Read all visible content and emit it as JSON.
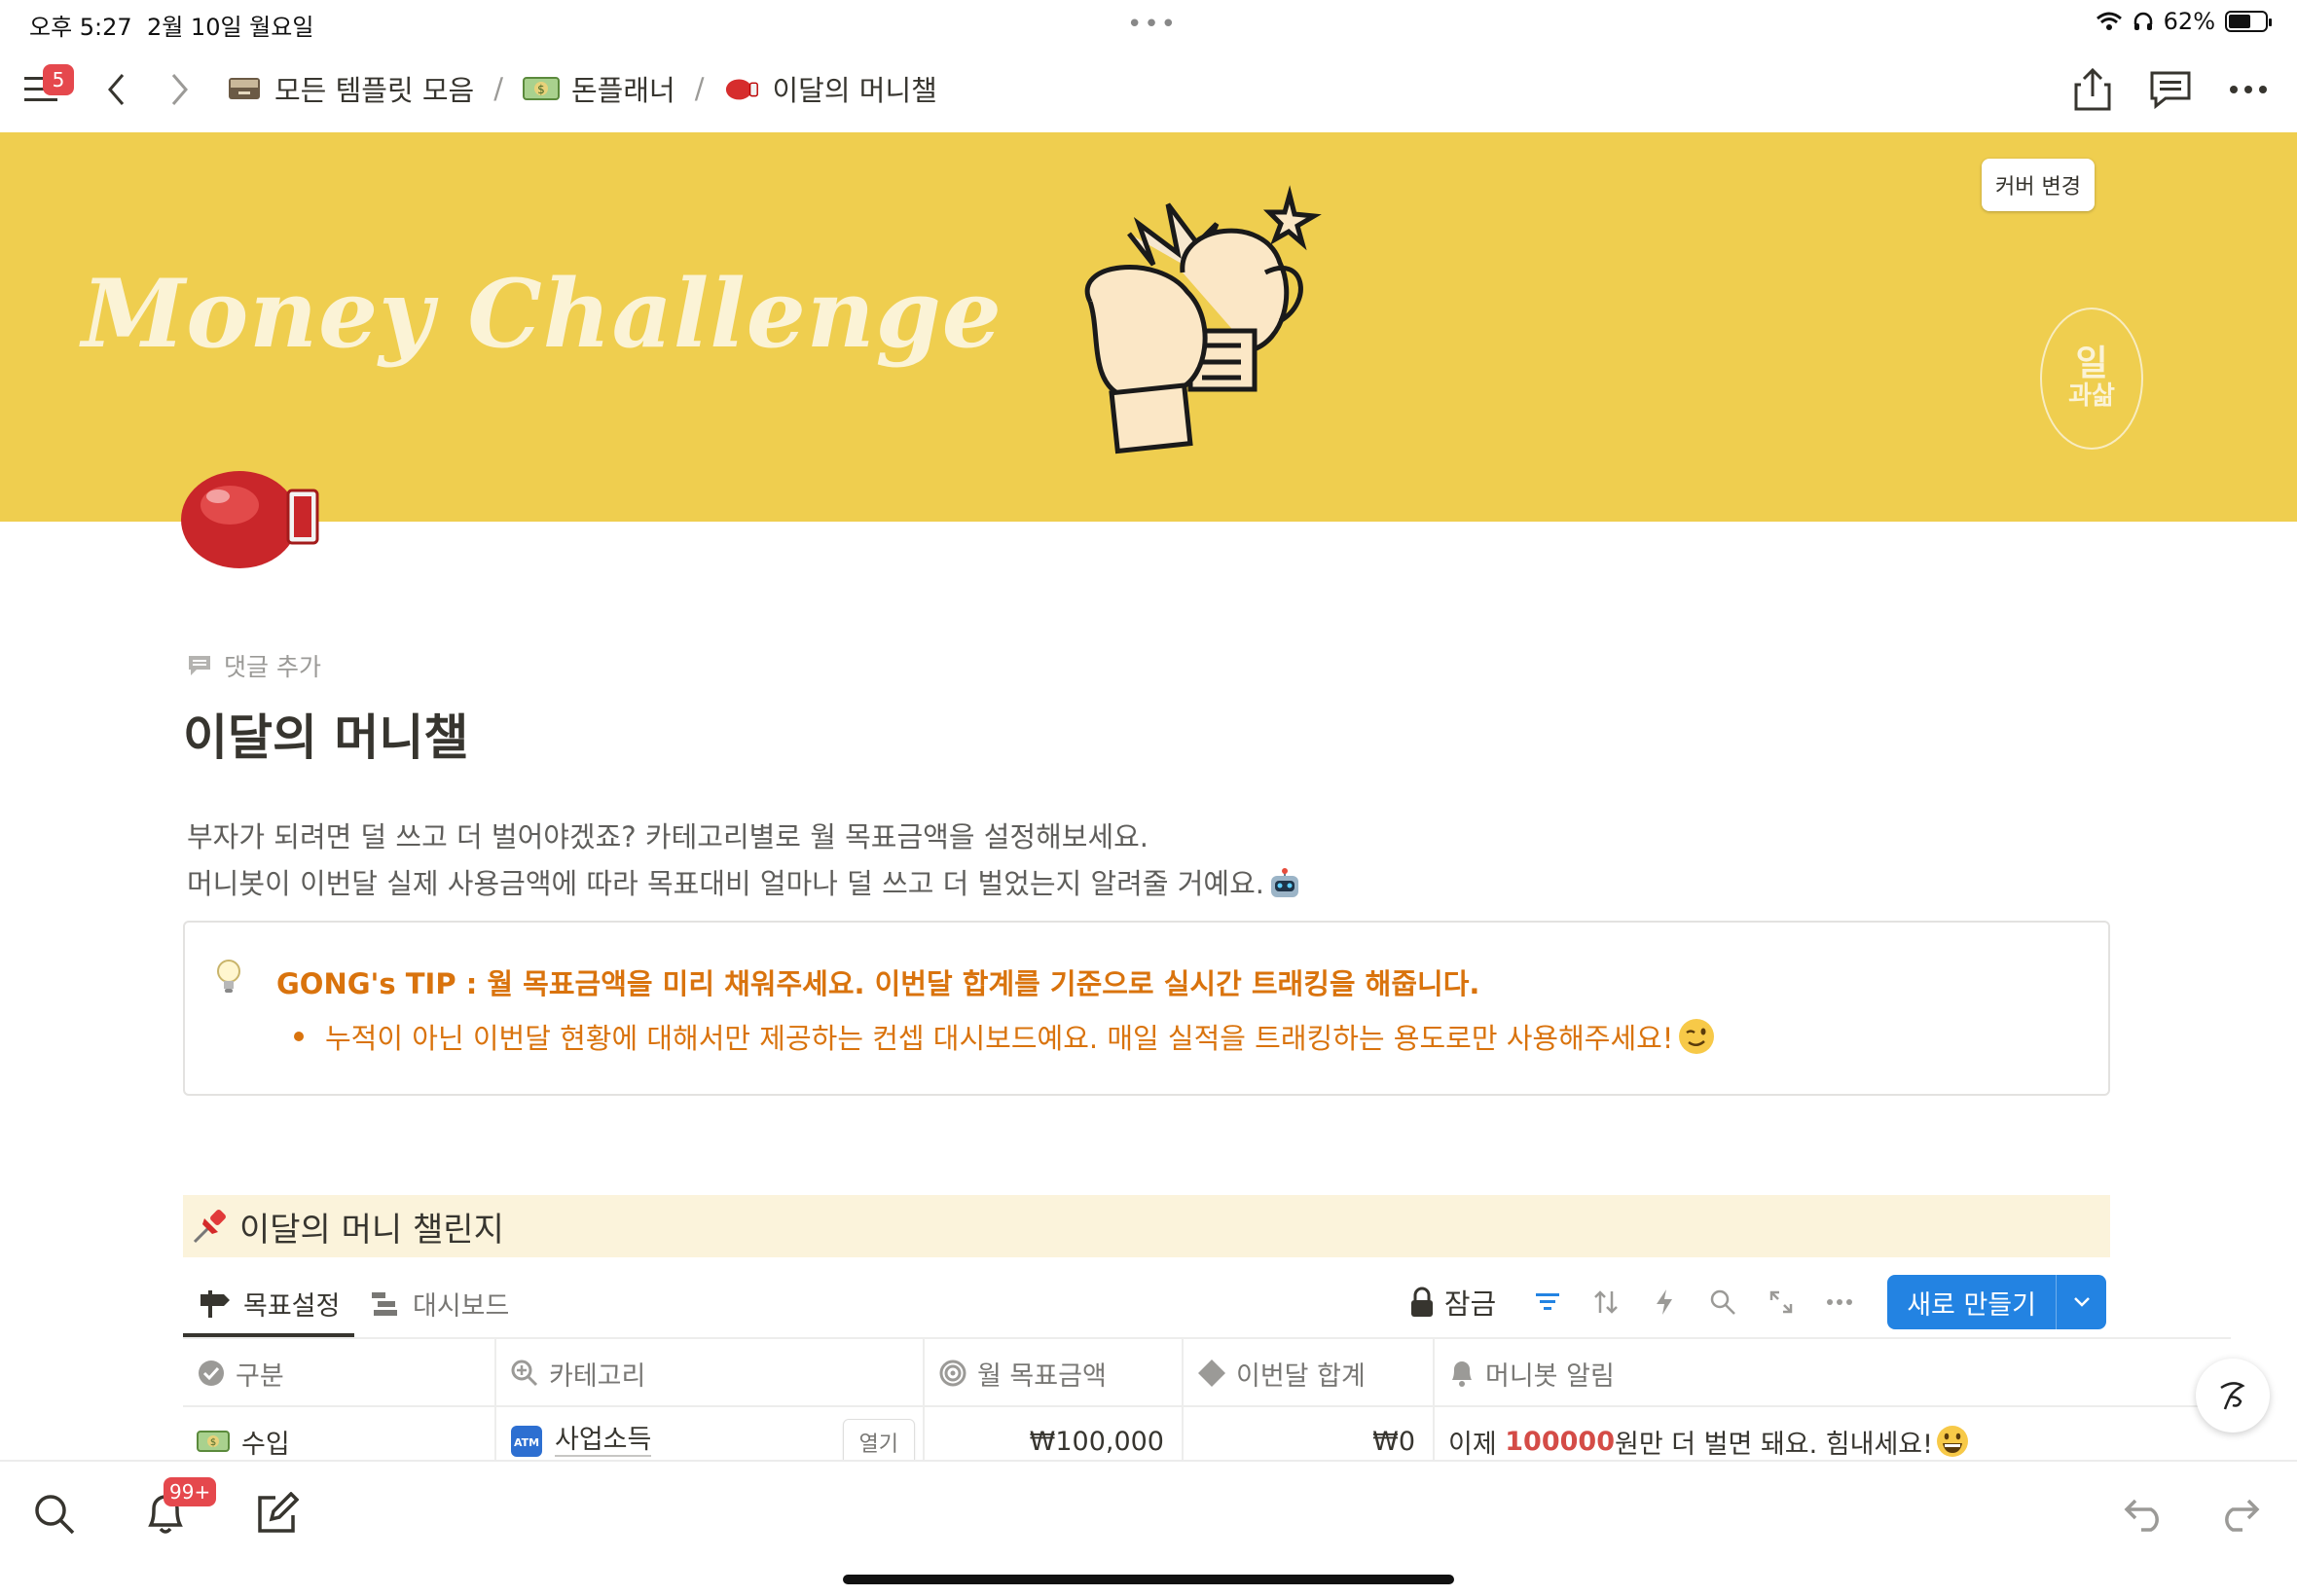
{
  "status": {
    "time": "오후 5:27",
    "date": "2월 10일 월요일",
    "battery": "62%",
    "battery_level": 0.62
  },
  "nav": {
    "sidebar_badge": "5",
    "breadcrumbs": [
      {
        "label": "모든 템플릿 모음",
        "icon": "file-cabinet-icon"
      },
      {
        "label": "돈플래너",
        "icon": "dollar-banknote-icon"
      },
      {
        "label": "이달의 머니챌",
        "icon": "boxing-glove-icon"
      }
    ],
    "separator": "/"
  },
  "cover": {
    "title": "Money Challenge",
    "change_cover": "커버 변경",
    "logo_top": "일",
    "logo_bottom": "과삶",
    "bg_color": "#efce4f"
  },
  "page": {
    "add_comment": "댓글 추가",
    "title": "이달의 머니챌",
    "desc_line1": "부자가 되려면 덜 쓰고 더 벌어야겠죠? 카테고리별로 월 목표금액을 설정해보세요.",
    "desc_line2": "머니봇이 이번달 실제 사용금액에 따라 목표대비 얼마나 덜 쓰고 더 벌었는지 알려줄 거예요.",
    "callout_title": "GONG's TIP : 월 목표금액을 미리 채워주세요. 이번달 합계를 기준으로 실시간 트래킹을 해줍니다.",
    "callout_bullet": "누적이 아닌 이번달 현황에 대해서만 제공하는 컨셉 대시보드예요. 매일 실적을 트래킹하는 용도로만 사용해주세요!",
    "section_title": "이달의 머니 챌린지"
  },
  "db": {
    "tabs": [
      {
        "label": "목표설정",
        "active": true
      },
      {
        "label": "대시보드",
        "active": false
      }
    ],
    "lock_label": "잠금",
    "new_button": "새로 만들기",
    "columns": [
      "구분",
      "카테고리",
      "월 목표금액",
      "이번달 합계",
      "머니봇 알림"
    ],
    "rows": [
      {
        "type": "수입",
        "category": "사업소득",
        "open": "열기",
        "target": "₩100,000",
        "total": "₩0",
        "alert_prefix": "이제 ",
        "alert_amount": "100000",
        "alert_suffix": "원만 더 벌면 돼요. 힘내세요!"
      }
    ]
  },
  "bottom": {
    "notif_badge": "99+"
  },
  "colors": {
    "accent": "#2383e2",
    "orange": "#d9730d",
    "red": "#d44c47",
    "section_bg": "#fbf3db"
  }
}
